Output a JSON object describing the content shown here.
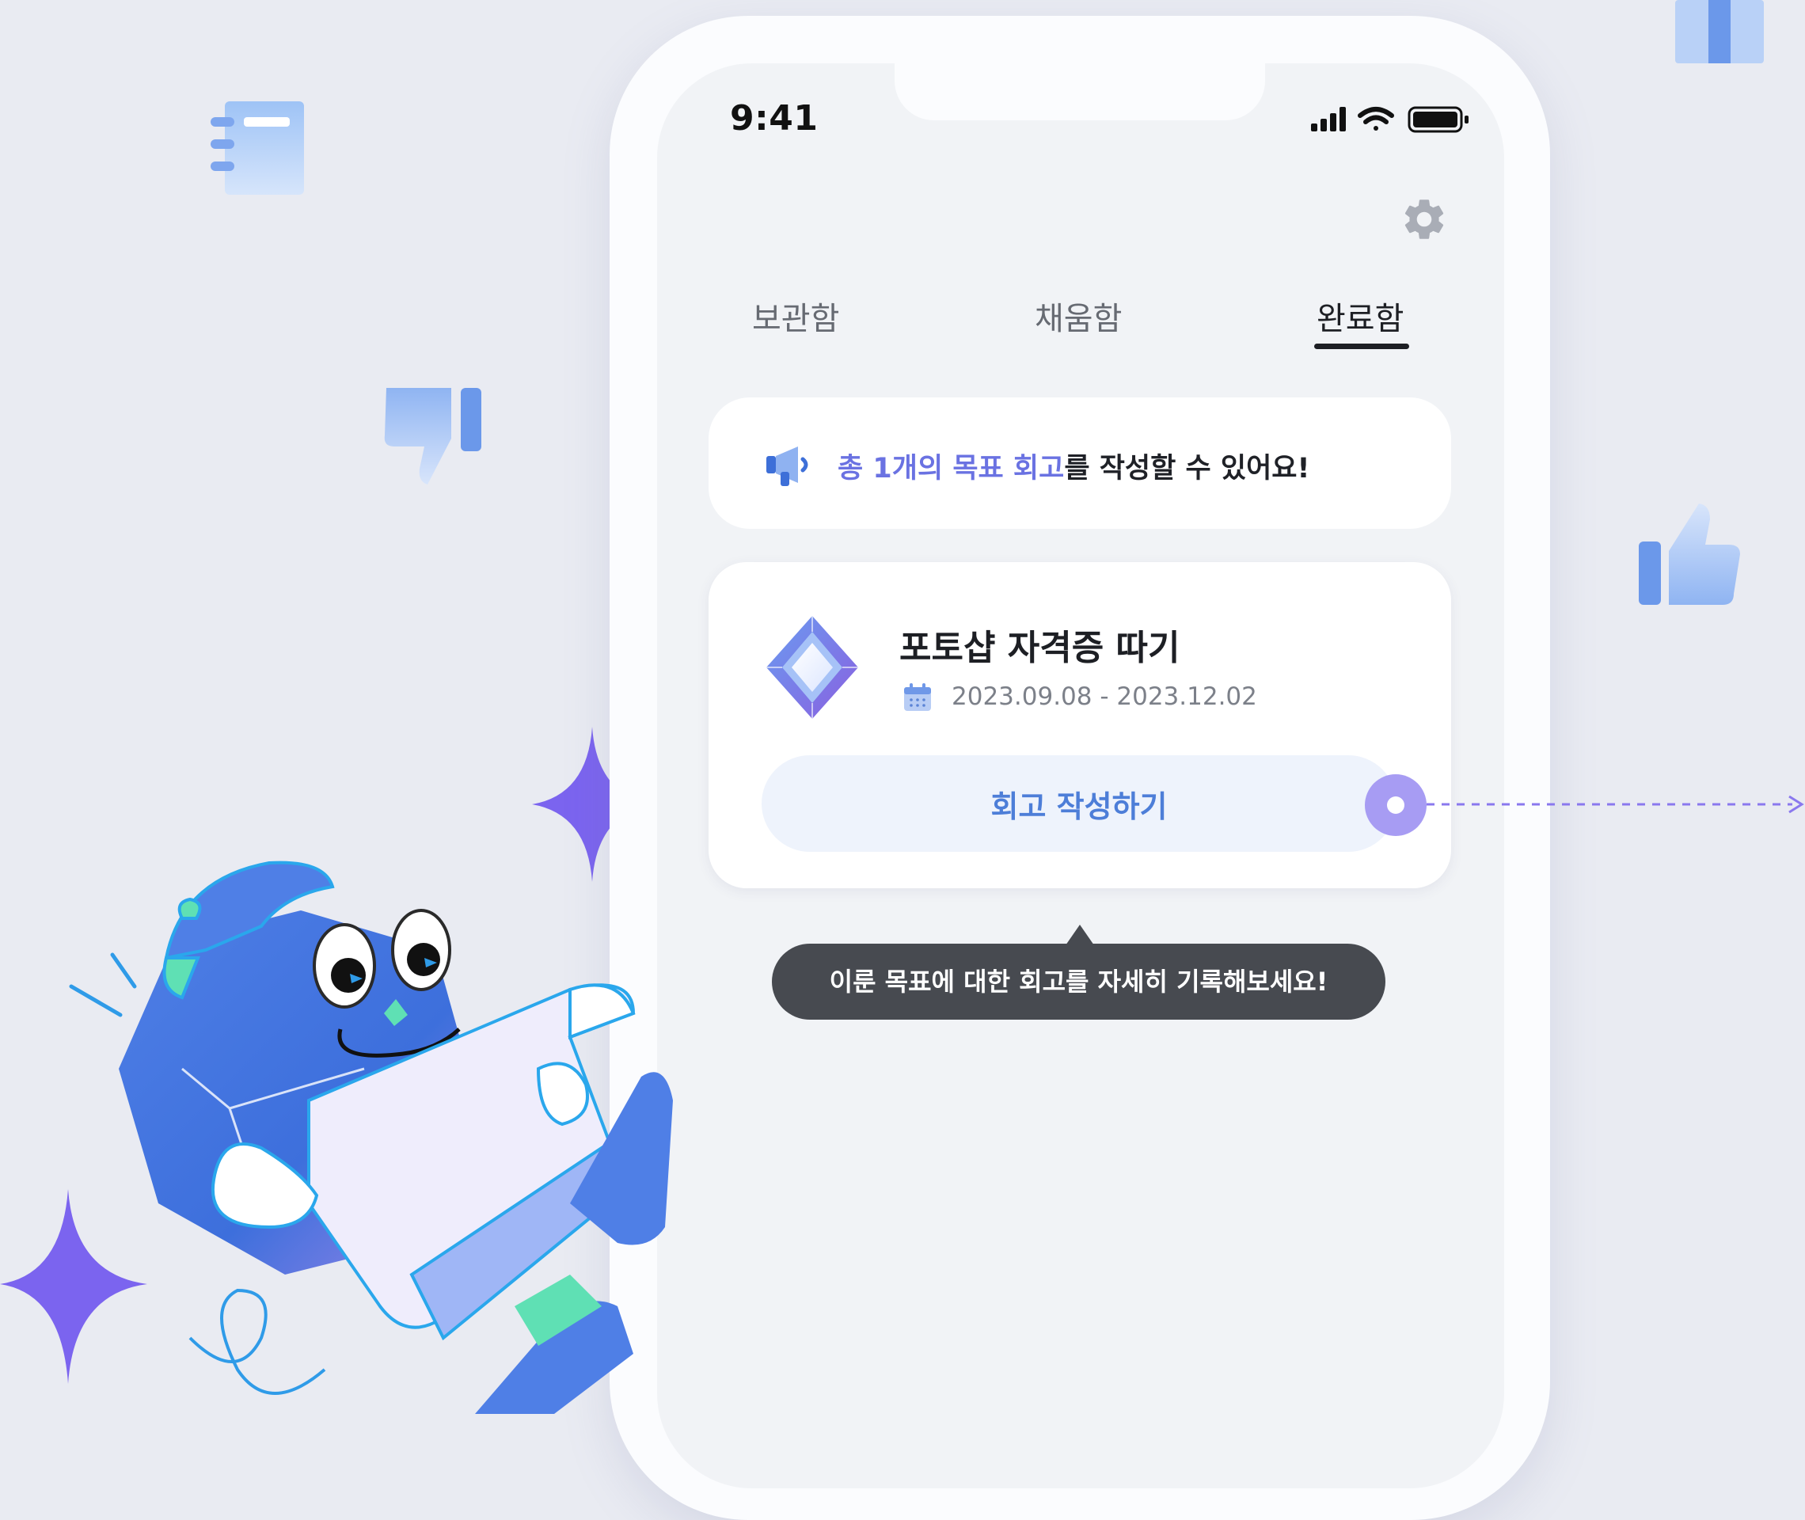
{
  "status_bar": {
    "time": "9:41"
  },
  "tabs": [
    {
      "label": "보관함",
      "active": false
    },
    {
      "label": "채움함",
      "active": false
    },
    {
      "label": "완료함",
      "active": true
    }
  ],
  "notice": {
    "highlight": "총 1개의 목표 회고",
    "rest": "를 작성할 수 있어요!",
    "icon": "megaphone-icon"
  },
  "goal": {
    "title": "포토샵 자격증 따기",
    "date_range": "2023.09.08 - 2023.12.02",
    "icon": "diamond-gem-icon",
    "button_label": "회고 작성하기"
  },
  "tooltip": {
    "text": "이룬 목표에 대한 회고를 자세히 기록해보세요!"
  },
  "colors": {
    "background": "#e9ebf2",
    "accent_purple": "#6a72e2",
    "button_text": "#4d7ed8",
    "tooltip_bg": "#474a50",
    "hotspot": "#a79cf3"
  }
}
